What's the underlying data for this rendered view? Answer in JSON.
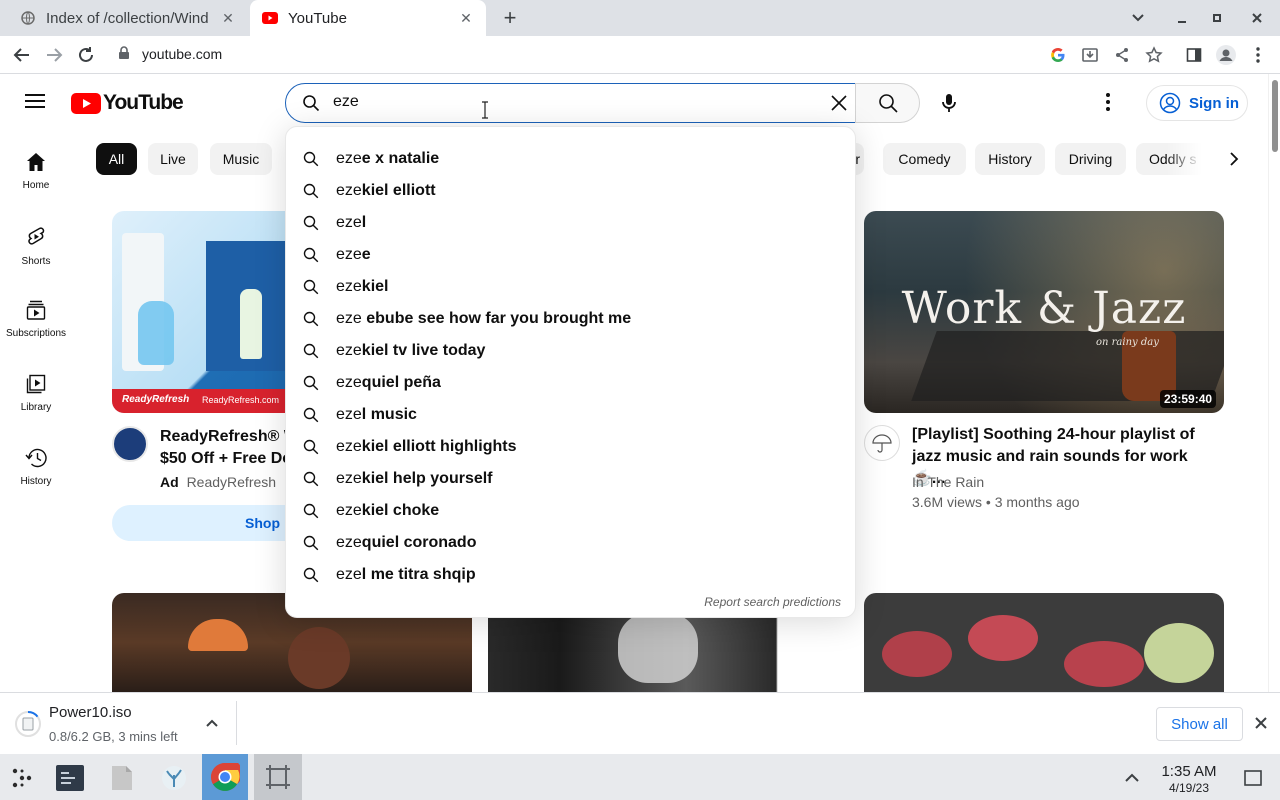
{
  "browser": {
    "tabs": [
      {
        "title": "Index of /collection/Wind",
        "active": false
      },
      {
        "title": "YouTube",
        "active": true
      }
    ],
    "url": "youtube.com"
  },
  "youtube": {
    "logo_text": "YouTube",
    "search": {
      "value": "eze"
    },
    "signin_label": "Sign in",
    "chips": [
      "All",
      "Live",
      "Music",
      "er",
      "Comedy",
      "History",
      "Driving",
      "Oddly s"
    ],
    "sidebar": [
      {
        "label": "Home",
        "icon": "home-icon"
      },
      {
        "label": "Shorts",
        "icon": "shorts-icon"
      },
      {
        "label": "Subscriptions",
        "icon": "subscriptions-icon"
      },
      {
        "label": "Library",
        "icon": "library-icon"
      },
      {
        "label": "History",
        "icon": "history-icon"
      }
    ],
    "suggestions": [
      {
        "typed": "eze",
        "rest": "e x natalie"
      },
      {
        "typed": "eze",
        "rest": "kiel elliott"
      },
      {
        "typed": "eze",
        "rest": "l"
      },
      {
        "typed": "eze",
        "rest": "e"
      },
      {
        "typed": "eze",
        "rest": "kiel"
      },
      {
        "typed": "eze",
        "rest": " ebube see how far you brought me"
      },
      {
        "typed": "eze",
        "rest": "kiel tv live today"
      },
      {
        "typed": "eze",
        "rest": "quiel peña"
      },
      {
        "typed": "eze",
        "rest": "l music"
      },
      {
        "typed": "eze",
        "rest": "kiel elliott highlights"
      },
      {
        "typed": "eze",
        "rest": "kiel help yourself"
      },
      {
        "typed": "eze",
        "rest": "kiel choke"
      },
      {
        "typed": "eze",
        "rest": "quiel coronado"
      },
      {
        "typed": "eze",
        "rest": "l me titra shqip"
      }
    ],
    "report_label": "Report search predictions",
    "ad": {
      "title_line1": "ReadyRefresh® W",
      "title_line2": "$50 Off + Free De",
      "ad_badge": "Ad",
      "advertiser": "ReadyRefresh",
      "cta": "Shop",
      "thumb_brand_left": "ReadyRefresh",
      "thumb_brand_right": "ReadyRefresh.com"
    },
    "video": {
      "thumb_title": "Work & Jazz",
      "thumb_subtitle": "on rainy day",
      "duration": "23:59:40",
      "title_line1": "[Playlist] Soothing 24-hour playlist of",
      "title_line2": "jazz music and rain sounds for work ☕...",
      "channel": "In The Rain",
      "meta": "3.6M views • 3 months ago"
    }
  },
  "download": {
    "filename": "Power10.iso",
    "status": "0.8/6.2 GB, 3 mins left",
    "show_all": "Show all"
  },
  "taskbar": {
    "time": "1:35 AM",
    "date": "4/19/23"
  },
  "colors": {
    "yt_red": "#ff0000",
    "link_blue": "#065fd4",
    "tab_strip": "#dee1e6",
    "taskbar": "#e8eaed"
  }
}
